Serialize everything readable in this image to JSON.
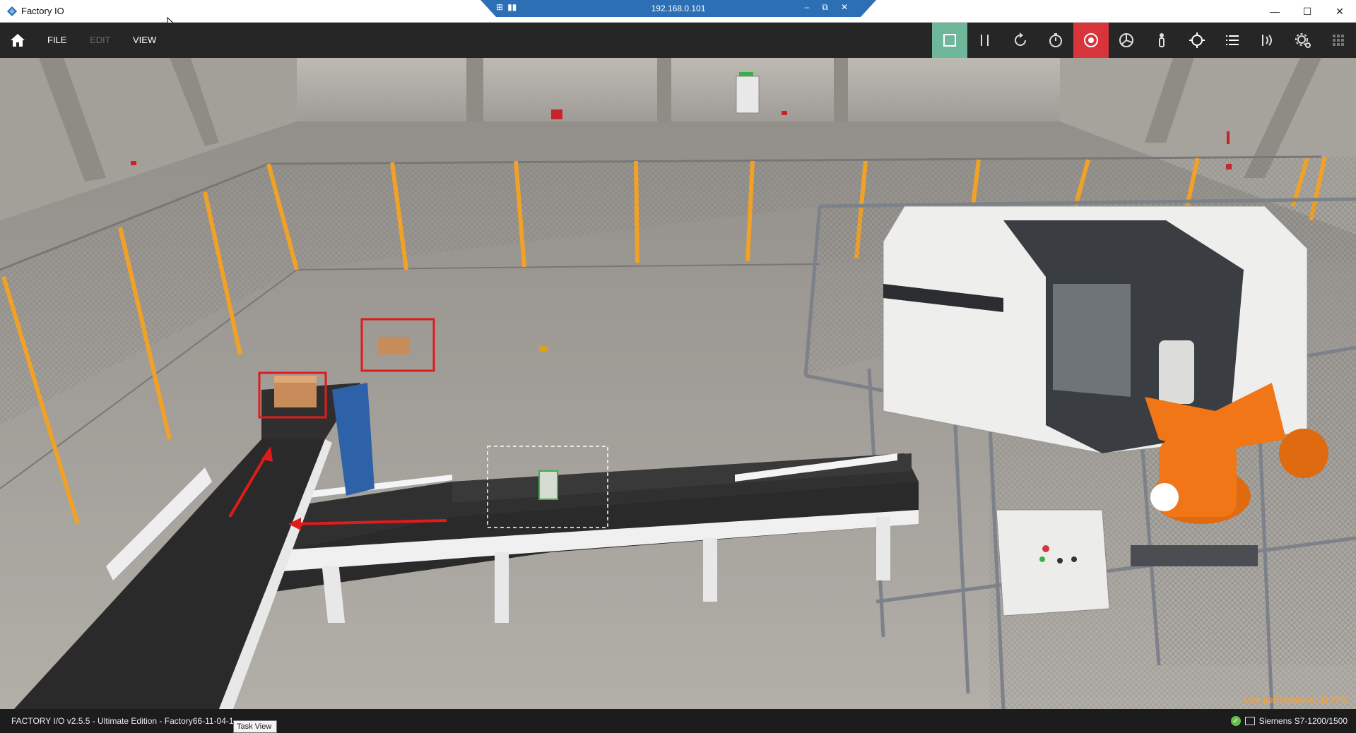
{
  "window": {
    "title": "Factory IO",
    "controls": {
      "minimize": "—",
      "maximize": "☐",
      "close": "✕"
    }
  },
  "remote_session": {
    "ip": "192.168.0.101",
    "icons": [
      "pin-icon",
      "signal-icon"
    ],
    "controls": {
      "minimize": "–",
      "restore": "⧉",
      "close": "✕"
    }
  },
  "menu": {
    "home_icon": "home-icon",
    "items": [
      {
        "label": "FILE",
        "enabled": true
      },
      {
        "label": "EDIT",
        "enabled": false
      },
      {
        "label": "VIEW",
        "enabled": true
      }
    ]
  },
  "toolbar": {
    "tools": [
      {
        "name": "stop-icon",
        "active_color": "#6fb79a"
      },
      {
        "name": "pause-icon"
      },
      {
        "name": "reset-icon"
      },
      {
        "name": "timer-icon"
      },
      {
        "name": "record-icon",
        "active_color": "#d8343c"
      },
      {
        "name": "camera-orbit-icon"
      },
      {
        "name": "person-icon"
      },
      {
        "name": "target-icon"
      },
      {
        "name": "list-icon"
      },
      {
        "name": "sensors-icon"
      },
      {
        "name": "settings-icon"
      },
      {
        "name": "grid-icon"
      }
    ]
  },
  "scene": {
    "performance_warning": "Low performance: 11 FPS"
  },
  "status": {
    "left": "FACTORY I/O v2.5.5 - Ultimate Edition - Factory66-11-04-1",
    "driver": "Siemens S7-1200/1500",
    "connected": true
  },
  "tooltip": "Task View"
}
